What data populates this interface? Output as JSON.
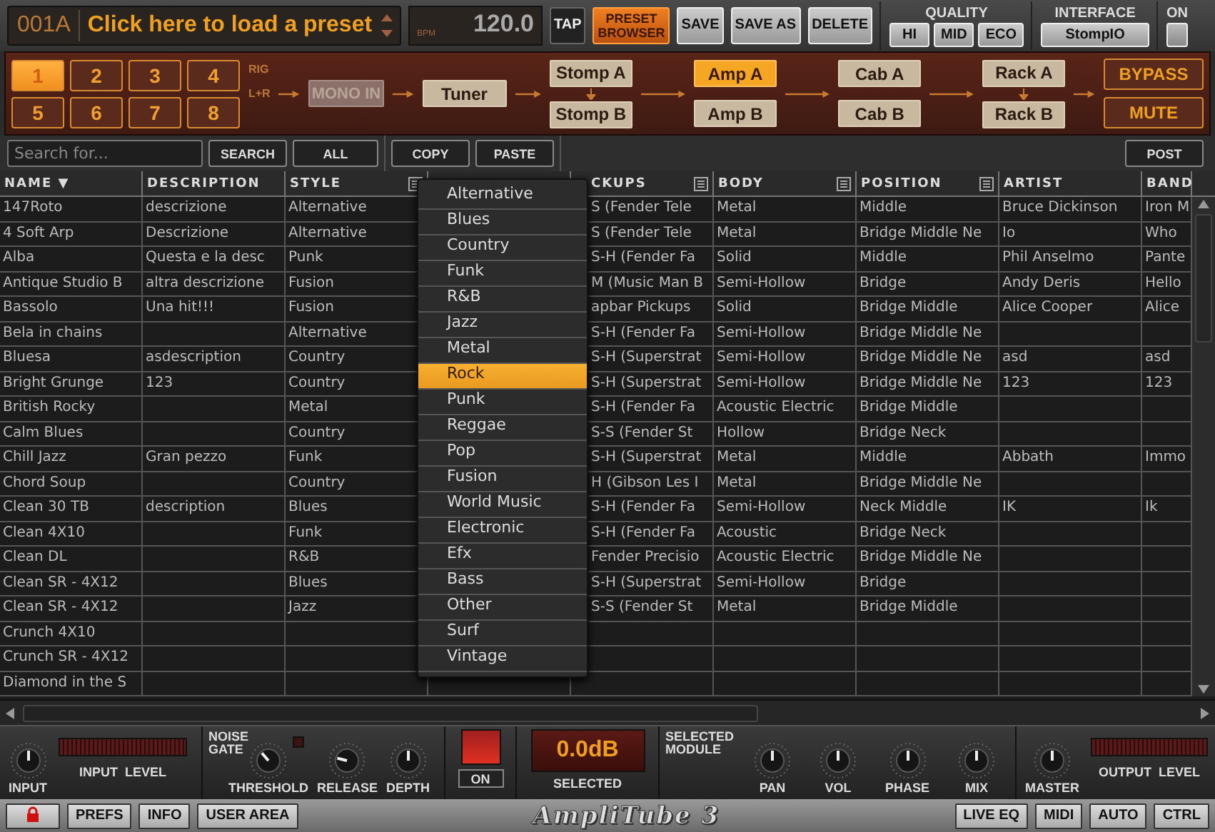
{
  "preset": {
    "number": "001A",
    "name": "Click here to load a preset"
  },
  "tempo": {
    "unit": "BPM",
    "value": "120.0"
  },
  "top_buttons": [
    {
      "label": "TAP",
      "kind": "dark"
    },
    {
      "label": "PRESET BROWSER",
      "kind": "orange"
    },
    {
      "label": "SAVE",
      "kind": "grey"
    },
    {
      "label": "SAVE AS",
      "kind": "grey"
    },
    {
      "label": "DELETE",
      "kind": "grey"
    }
  ],
  "quality": {
    "title": "QUALITY",
    "options": [
      "HI",
      "MID",
      "ECO"
    ]
  },
  "interface": {
    "title": "INTERFACE",
    "value": "StompIO"
  },
  "on_toggle": {
    "label": "ON",
    "on": false
  },
  "rig": {
    "labels": [
      "RIG",
      "L+R"
    ],
    "buttons": [
      {
        "label": "1",
        "selected": true
      },
      {
        "label": "2",
        "selected": false
      },
      {
        "label": "3",
        "selected": false
      },
      {
        "label": "4",
        "selected": false
      },
      {
        "label": "5",
        "selected": false
      },
      {
        "label": "6",
        "selected": false
      },
      {
        "label": "7",
        "selected": false
      },
      {
        "label": "8",
        "selected": false
      }
    ]
  },
  "chain": {
    "input": {
      "label": "MONO IN",
      "disabled": true
    },
    "tuner": {
      "label": "Tuner",
      "disabled": false
    },
    "stages": [
      {
        "linked": true,
        "modules": [
          {
            "label": "Stomp A",
            "selected": false
          },
          {
            "label": "Stomp B",
            "selected": false
          }
        ]
      },
      {
        "linked": false,
        "modules": [
          {
            "label": "Amp A",
            "selected": true
          },
          {
            "label": "Amp B",
            "selected": false
          }
        ]
      },
      {
        "linked": false,
        "modules": [
          {
            "label": "Cab A",
            "selected": false
          },
          {
            "label": "Cab B",
            "selected": false
          }
        ]
      },
      {
        "linked": true,
        "modules": [
          {
            "label": "Rack A",
            "selected": false
          },
          {
            "label": "Rack B",
            "selected": false
          }
        ]
      }
    ],
    "outputs": [
      "BYPASS",
      "MUTE"
    ]
  },
  "toolbar": {
    "search_placeholder": "Search for...",
    "search_buttons": [
      "SEARCH",
      "ALL"
    ],
    "edit_buttons": [
      "COPY",
      "PASTE"
    ],
    "post_button": "POST"
  },
  "table": {
    "columns": [
      {
        "label": "NAME",
        "sort_mark": "▼"
      },
      {
        "label": "DESCRIPTION"
      },
      {
        "label": "STYLE",
        "filter": true
      },
      {
        "label": "CKUPS",
        "filter": true
      },
      {
        "label": "BODY",
        "filter": true
      },
      {
        "label": "POSITION",
        "filter": true
      },
      {
        "label": "ARTIST"
      },
      {
        "label": "BAND"
      }
    ],
    "rows": [
      {
        "name": "147Roto",
        "description": "descrizione",
        "style": "Alternative",
        "pickups": "S (Fender Tele",
        "body": "Metal",
        "position": "Middle",
        "artist": "Bruce Dickinson",
        "band": "Iron M"
      },
      {
        "name": "4 Soft Arp",
        "description": "Descrizione",
        "style": "Alternative",
        "pickups": "S (Fender Tele",
        "body": "Metal",
        "position": "Bridge Middle Ne",
        "artist": "Io",
        "band": "Who"
      },
      {
        "name": "Alba",
        "description": "Questa e la desc",
        "style": "Punk",
        "pickups": "S-H (Fender Fa",
        "body": "Solid",
        "position": "Middle",
        "artist": "Phil Anselmo",
        "band": "Pante"
      },
      {
        "name": "Antique Studio B",
        "description": "altra descrizione",
        "style": "Fusion",
        "pickups": "M (Music Man B",
        "body": "Semi-Hollow",
        "position": "Bridge",
        "artist": "Andy Deris",
        "band": "Hello"
      },
      {
        "name": "Bassolo",
        "description": "Una hit!!!",
        "style": "Fusion",
        "pickups": "apbar Pickups",
        "body": "Solid",
        "position": "Bridge Middle",
        "artist": "Alice Cooper",
        "band": "Alice"
      },
      {
        "name": "Bela in chains",
        "style": "Alternative",
        "pickups": "S-H (Fender Fa",
        "body": "Semi-Hollow",
        "position": "Bridge Middle Ne"
      },
      {
        "name": "Bluesa",
        "description": "asdescription",
        "style": "Country",
        "pickups": "S-H (Superstrat",
        "body": "Semi-Hollow",
        "position": "Bridge Middle Ne",
        "artist": "asd",
        "band": "asd"
      },
      {
        "name": "Bright Grunge",
        "description": "123",
        "style": "Country",
        "pickups": "S-H (Superstrat",
        "body": "Semi-Hollow",
        "position": "Bridge Middle Ne",
        "artist": "123",
        "band": "123"
      },
      {
        "name": "British Rocky",
        "style": "Metal",
        "pickups": "S-H (Fender Fa",
        "body": "Acoustic Electric",
        "position": "Bridge Middle"
      },
      {
        "name": "Calm Blues",
        "style": "Country",
        "pickups": "S-S (Fender St",
        "body": "Hollow",
        "position": "Bridge Neck"
      },
      {
        "name": "Chill Jazz",
        "description": "Gran pezzo",
        "style": "Funk",
        "pickups": "S-H (Superstrat",
        "body": "Metal",
        "position": "Middle",
        "artist": "Abbath",
        "band": "Immo"
      },
      {
        "name": "Chord Soup",
        "style": "Country",
        "pickups": "H (Gibson Les I",
        "body": "Metal",
        "position": "Bridge Middle Ne"
      },
      {
        "name": "Clean 30 TB",
        "description": "description",
        "style": "Blues",
        "pickups": "S-H (Fender Fa",
        "body": "Semi-Hollow",
        "position": "Neck Middle",
        "artist": "IK",
        "band": "Ik"
      },
      {
        "name": "Clean 4X10",
        "style": "Funk",
        "pickups": "S-H (Fender Fa",
        "body": "Acoustic",
        "position": "Bridge Neck"
      },
      {
        "name": "Clean DL",
        "style": "R&B",
        "pickups": "Fender Precisio",
        "body": "Acoustic Electric",
        "position": "Bridge Middle Ne"
      },
      {
        "name": "Clean SR - 4X12",
        "style": "Blues",
        "pickups": "S-H (Superstrat",
        "body": "Semi-Hollow",
        "position": "Bridge"
      },
      {
        "name": "Clean SR - 4X12",
        "style": "Jazz",
        "pickups": "S-S (Fender St",
        "body": "Metal",
        "position": "Bridge Middle"
      },
      {
        "name": "Crunch 4X10"
      },
      {
        "name": "Crunch SR - 4X12"
      },
      {
        "name": "Diamond in the S"
      }
    ]
  },
  "style_menu": {
    "items": [
      {
        "label": "Alternative",
        "selected": false
      },
      {
        "label": "Blues",
        "selected": false
      },
      {
        "label": "Country",
        "selected": false
      },
      {
        "label": "Funk",
        "selected": false
      },
      {
        "label": "R&B",
        "selected": false
      },
      {
        "label": "Jazz",
        "selected": false
      },
      {
        "label": "Metal",
        "selected": false
      },
      {
        "label": "Rock",
        "selected": true
      },
      {
        "label": "Punk",
        "selected": false
      },
      {
        "label": "Reggae",
        "selected": false
      },
      {
        "label": "Pop",
        "selected": false
      },
      {
        "label": "Fusion",
        "selected": false
      },
      {
        "label": "World Music",
        "selected": false
      },
      {
        "label": "Electronic",
        "selected": false
      },
      {
        "label": "Efx",
        "selected": false
      },
      {
        "label": "Bass",
        "selected": false
      },
      {
        "label": "Other",
        "selected": false
      },
      {
        "label": "Surf",
        "selected": false
      },
      {
        "label": "Vintage",
        "selected": false
      }
    ]
  },
  "controls": {
    "input": {
      "label": "INPUT",
      "level": 0.5
    },
    "input_meter": "INPUT  LEVEL",
    "noise_gate": {
      "title": "NOISE GATE",
      "led_on": false,
      "knobs": [
        {
          "label": "THRESHOLD",
          "level": 0.35
        },
        {
          "label": "RELEASE",
          "level": 0.22
        },
        {
          "label": "DEPTH",
          "level": 0.5
        }
      ]
    },
    "gate_switch": {
      "label": "ON",
      "on": true
    },
    "display": {
      "value": "0.0dB",
      "label": "SELECTED"
    },
    "module": {
      "title": "SELECTED MODULE",
      "knobs": [
        {
          "label": "PAN",
          "level": 0.5
        },
        {
          "label": "VOL",
          "level": 0.5
        },
        {
          "label": "PHASE",
          "level": 0.5
        },
        {
          "label": "MIX",
          "level": 0.5
        }
      ]
    },
    "master": {
      "label": "MASTER",
      "level": 0.5
    },
    "output_meter": "OUTPUT  LEVEL"
  },
  "footer": {
    "left_buttons": [
      "PREFS",
      "INFO",
      "USER AREA"
    ],
    "logo": "AmpliTube 3",
    "right_buttons": [
      "LIVE EQ",
      "MIDI",
      "AUTO",
      "CTRL"
    ]
  }
}
